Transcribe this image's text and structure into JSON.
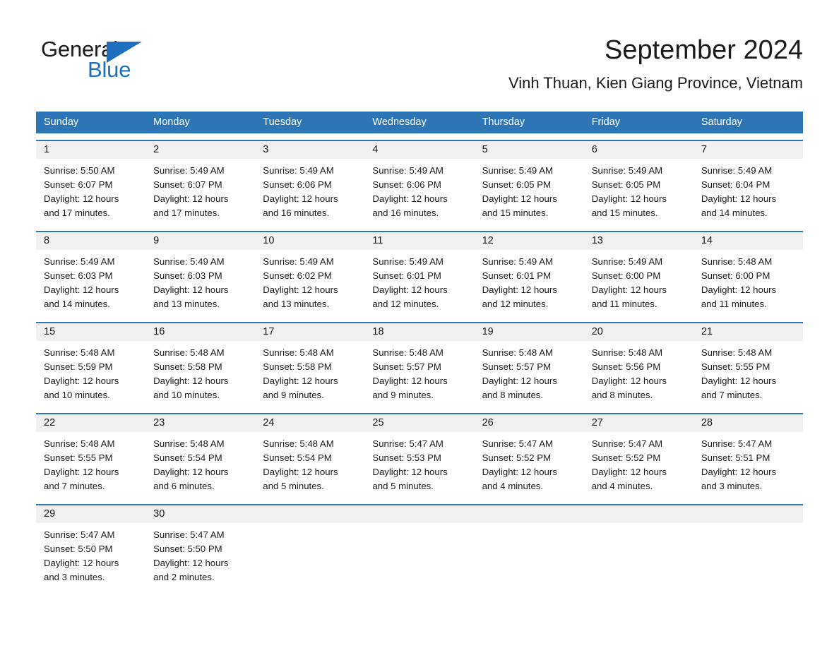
{
  "brand": {
    "name_part1": "General",
    "name_part2": "Blue",
    "triangle_color": "#1f6fbe",
    "text_color": "#1a1a1a"
  },
  "header": {
    "title": "September 2024",
    "subtitle": "Vinh Thuan, Kien Giang Province, Vietnam"
  },
  "theme": {
    "header_bg": "#2e75b6",
    "header_text": "#ffffff",
    "daynum_band_bg": "#f0f0f0",
    "row_separator": "#2e75b6",
    "cell_text": "#1a1a1a",
    "page_bg": "#ffffff"
  },
  "weekdays": [
    "Sunday",
    "Monday",
    "Tuesday",
    "Wednesday",
    "Thursday",
    "Friday",
    "Saturday"
  ],
  "weeks": [
    {
      "days": [
        {
          "num": "1",
          "sunrise": "Sunrise: 5:50 AM",
          "sunset": "Sunset: 6:07 PM",
          "daylight1": "Daylight: 12 hours",
          "daylight2": "and 17 minutes."
        },
        {
          "num": "2",
          "sunrise": "Sunrise: 5:49 AM",
          "sunset": "Sunset: 6:07 PM",
          "daylight1": "Daylight: 12 hours",
          "daylight2": "and 17 minutes."
        },
        {
          "num": "3",
          "sunrise": "Sunrise: 5:49 AM",
          "sunset": "Sunset: 6:06 PM",
          "daylight1": "Daylight: 12 hours",
          "daylight2": "and 16 minutes."
        },
        {
          "num": "4",
          "sunrise": "Sunrise: 5:49 AM",
          "sunset": "Sunset: 6:06 PM",
          "daylight1": "Daylight: 12 hours",
          "daylight2": "and 16 minutes."
        },
        {
          "num": "5",
          "sunrise": "Sunrise: 5:49 AM",
          "sunset": "Sunset: 6:05 PM",
          "daylight1": "Daylight: 12 hours",
          "daylight2": "and 15 minutes."
        },
        {
          "num": "6",
          "sunrise": "Sunrise: 5:49 AM",
          "sunset": "Sunset: 6:05 PM",
          "daylight1": "Daylight: 12 hours",
          "daylight2": "and 15 minutes."
        },
        {
          "num": "7",
          "sunrise": "Sunrise: 5:49 AM",
          "sunset": "Sunset: 6:04 PM",
          "daylight1": "Daylight: 12 hours",
          "daylight2": "and 14 minutes."
        }
      ]
    },
    {
      "days": [
        {
          "num": "8",
          "sunrise": "Sunrise: 5:49 AM",
          "sunset": "Sunset: 6:03 PM",
          "daylight1": "Daylight: 12 hours",
          "daylight2": "and 14 minutes."
        },
        {
          "num": "9",
          "sunrise": "Sunrise: 5:49 AM",
          "sunset": "Sunset: 6:03 PM",
          "daylight1": "Daylight: 12 hours",
          "daylight2": "and 13 minutes."
        },
        {
          "num": "10",
          "sunrise": "Sunrise: 5:49 AM",
          "sunset": "Sunset: 6:02 PM",
          "daylight1": "Daylight: 12 hours",
          "daylight2": "and 13 minutes."
        },
        {
          "num": "11",
          "sunrise": "Sunrise: 5:49 AM",
          "sunset": "Sunset: 6:01 PM",
          "daylight1": "Daylight: 12 hours",
          "daylight2": "and 12 minutes."
        },
        {
          "num": "12",
          "sunrise": "Sunrise: 5:49 AM",
          "sunset": "Sunset: 6:01 PM",
          "daylight1": "Daylight: 12 hours",
          "daylight2": "and 12 minutes."
        },
        {
          "num": "13",
          "sunrise": "Sunrise: 5:49 AM",
          "sunset": "Sunset: 6:00 PM",
          "daylight1": "Daylight: 12 hours",
          "daylight2": "and 11 minutes."
        },
        {
          "num": "14",
          "sunrise": "Sunrise: 5:48 AM",
          "sunset": "Sunset: 6:00 PM",
          "daylight1": "Daylight: 12 hours",
          "daylight2": "and 11 minutes."
        }
      ]
    },
    {
      "days": [
        {
          "num": "15",
          "sunrise": "Sunrise: 5:48 AM",
          "sunset": "Sunset: 5:59 PM",
          "daylight1": "Daylight: 12 hours",
          "daylight2": "and 10 minutes."
        },
        {
          "num": "16",
          "sunrise": "Sunrise: 5:48 AM",
          "sunset": "Sunset: 5:58 PM",
          "daylight1": "Daylight: 12 hours",
          "daylight2": "and 10 minutes."
        },
        {
          "num": "17",
          "sunrise": "Sunrise: 5:48 AM",
          "sunset": "Sunset: 5:58 PM",
          "daylight1": "Daylight: 12 hours",
          "daylight2": "and 9 minutes."
        },
        {
          "num": "18",
          "sunrise": "Sunrise: 5:48 AM",
          "sunset": "Sunset: 5:57 PM",
          "daylight1": "Daylight: 12 hours",
          "daylight2": "and 9 minutes."
        },
        {
          "num": "19",
          "sunrise": "Sunrise: 5:48 AM",
          "sunset": "Sunset: 5:57 PM",
          "daylight1": "Daylight: 12 hours",
          "daylight2": "and 8 minutes."
        },
        {
          "num": "20",
          "sunrise": "Sunrise: 5:48 AM",
          "sunset": "Sunset: 5:56 PM",
          "daylight1": "Daylight: 12 hours",
          "daylight2": "and 8 minutes."
        },
        {
          "num": "21",
          "sunrise": "Sunrise: 5:48 AM",
          "sunset": "Sunset: 5:55 PM",
          "daylight1": "Daylight: 12 hours",
          "daylight2": "and 7 minutes."
        }
      ]
    },
    {
      "days": [
        {
          "num": "22",
          "sunrise": "Sunrise: 5:48 AM",
          "sunset": "Sunset: 5:55 PM",
          "daylight1": "Daylight: 12 hours",
          "daylight2": "and 7 minutes."
        },
        {
          "num": "23",
          "sunrise": "Sunrise: 5:48 AM",
          "sunset": "Sunset: 5:54 PM",
          "daylight1": "Daylight: 12 hours",
          "daylight2": "and 6 minutes."
        },
        {
          "num": "24",
          "sunrise": "Sunrise: 5:48 AM",
          "sunset": "Sunset: 5:54 PM",
          "daylight1": "Daylight: 12 hours",
          "daylight2": "and 5 minutes."
        },
        {
          "num": "25",
          "sunrise": "Sunrise: 5:47 AM",
          "sunset": "Sunset: 5:53 PM",
          "daylight1": "Daylight: 12 hours",
          "daylight2": "and 5 minutes."
        },
        {
          "num": "26",
          "sunrise": "Sunrise: 5:47 AM",
          "sunset": "Sunset: 5:52 PM",
          "daylight1": "Daylight: 12 hours",
          "daylight2": "and 4 minutes."
        },
        {
          "num": "27",
          "sunrise": "Sunrise: 5:47 AM",
          "sunset": "Sunset: 5:52 PM",
          "daylight1": "Daylight: 12 hours",
          "daylight2": "and 4 minutes."
        },
        {
          "num": "28",
          "sunrise": "Sunrise: 5:47 AM",
          "sunset": "Sunset: 5:51 PM",
          "daylight1": "Daylight: 12 hours",
          "daylight2": "and 3 minutes."
        }
      ]
    },
    {
      "days": [
        {
          "num": "29",
          "sunrise": "Sunrise: 5:47 AM",
          "sunset": "Sunset: 5:50 PM",
          "daylight1": "Daylight: 12 hours",
          "daylight2": "and 3 minutes."
        },
        {
          "num": "30",
          "sunrise": "Sunrise: 5:47 AM",
          "sunset": "Sunset: 5:50 PM",
          "daylight1": "Daylight: 12 hours",
          "daylight2": "and 2 minutes."
        },
        {
          "num": "",
          "sunrise": "",
          "sunset": "",
          "daylight1": "",
          "daylight2": ""
        },
        {
          "num": "",
          "sunrise": "",
          "sunset": "",
          "daylight1": "",
          "daylight2": ""
        },
        {
          "num": "",
          "sunrise": "",
          "sunset": "",
          "daylight1": "",
          "daylight2": ""
        },
        {
          "num": "",
          "sunrise": "",
          "sunset": "",
          "daylight1": "",
          "daylight2": ""
        },
        {
          "num": "",
          "sunrise": "",
          "sunset": "",
          "daylight1": "",
          "daylight2": ""
        }
      ]
    }
  ]
}
